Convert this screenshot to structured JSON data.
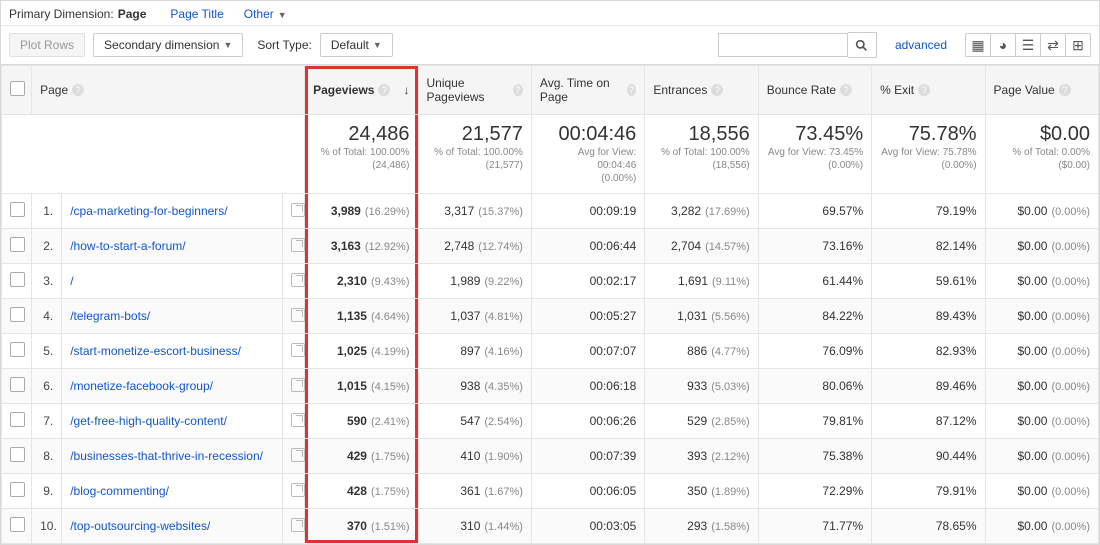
{
  "top": {
    "primary_dim_label": "Primary Dimension:",
    "primary_dim_value": "Page",
    "page_title_link": "Page Title",
    "other_link": "Other"
  },
  "controls": {
    "plot_rows": "Plot Rows",
    "secondary_dim": "Secondary dimension",
    "sort_type_label": "Sort Type:",
    "sort_type_value": "Default",
    "advanced": "advanced",
    "search_placeholder": ""
  },
  "headers": {
    "page": "Page",
    "pageviews": "Pageviews",
    "unique": "Unique Pageviews",
    "avgtime": "Avg. Time on Page",
    "entrances": "Entrances",
    "bounce": "Bounce Rate",
    "exit": "% Exit",
    "value": "Page Value"
  },
  "summary": {
    "pageviews": {
      "v": "24,486",
      "sub1": "% of Total: 100.00%",
      "sub2": "(24,486)"
    },
    "unique": {
      "v": "21,577",
      "sub1": "% of Total: 100.00%",
      "sub2": "(21,577)"
    },
    "avgtime": {
      "v": "00:04:46",
      "sub1": "Avg for View: 00:04:46",
      "sub2": "(0.00%)"
    },
    "entrances": {
      "v": "18,556",
      "sub1": "% of Total: 100.00%",
      "sub2": "(18,556)"
    },
    "bounce": {
      "v": "73.45%",
      "sub1": "Avg for View: 73.45%",
      "sub2": "(0.00%)"
    },
    "exit": {
      "v": "75.78%",
      "sub1": "Avg for View: 75.78%",
      "sub2": "(0.00%)"
    },
    "value": {
      "v": "$0.00",
      "sub1": "% of Total: 0.00%",
      "sub2": "($0.00)"
    }
  },
  "rows": [
    {
      "idx": "1.",
      "page": "/cpa-marketing-for-beginners/",
      "pv": "3,989",
      "pvp": "(16.29%)",
      "un": "3,317",
      "unp": "(15.37%)",
      "at": "00:09:19",
      "en": "3,282",
      "enp": "(17.69%)",
      "br": "69.57%",
      "ex": "79.19%",
      "vl": "$0.00",
      "vlp": "(0.00%)"
    },
    {
      "idx": "2.",
      "page": "/how-to-start-a-forum/",
      "pv": "3,163",
      "pvp": "(12.92%)",
      "un": "2,748",
      "unp": "(12.74%)",
      "at": "00:06:44",
      "en": "2,704",
      "enp": "(14.57%)",
      "br": "73.16%",
      "ex": "82.14%",
      "vl": "$0.00",
      "vlp": "(0.00%)"
    },
    {
      "idx": "3.",
      "page": "/",
      "pv": "2,310",
      "pvp": "(9.43%)",
      "un": "1,989",
      "unp": "(9.22%)",
      "at": "00:02:17",
      "en": "1,691",
      "enp": "(9.11%)",
      "br": "61.44%",
      "ex": "59.61%",
      "vl": "$0.00",
      "vlp": "(0.00%)"
    },
    {
      "idx": "4.",
      "page": "/telegram-bots/",
      "pv": "1,135",
      "pvp": "(4.64%)",
      "un": "1,037",
      "unp": "(4.81%)",
      "at": "00:05:27",
      "en": "1,031",
      "enp": "(5.56%)",
      "br": "84.22%",
      "ex": "89.43%",
      "vl": "$0.00",
      "vlp": "(0.00%)"
    },
    {
      "idx": "5.",
      "page": "/start-monetize-escort-business/",
      "pv": "1,025",
      "pvp": "(4.19%)",
      "un": "897",
      "unp": "(4.16%)",
      "at": "00:07:07",
      "en": "886",
      "enp": "(4.77%)",
      "br": "76.09%",
      "ex": "82.93%",
      "vl": "$0.00",
      "vlp": "(0.00%)"
    },
    {
      "idx": "6.",
      "page": "/monetize-facebook-group/",
      "pv": "1,015",
      "pvp": "(4.15%)",
      "un": "938",
      "unp": "(4.35%)",
      "at": "00:06:18",
      "en": "933",
      "enp": "(5.03%)",
      "br": "80.06%",
      "ex": "89.46%",
      "vl": "$0.00",
      "vlp": "(0.00%)"
    },
    {
      "idx": "7.",
      "page": "/get-free-high-quality-content/",
      "pv": "590",
      "pvp": "(2.41%)",
      "un": "547",
      "unp": "(2.54%)",
      "at": "00:06:26",
      "en": "529",
      "enp": "(2.85%)",
      "br": "79.81%",
      "ex": "87.12%",
      "vl": "$0.00",
      "vlp": "(0.00%)"
    },
    {
      "idx": "8.",
      "page": "/businesses-that-thrive-in-recession/",
      "pv": "429",
      "pvp": "(1.75%)",
      "un": "410",
      "unp": "(1.90%)",
      "at": "00:07:39",
      "en": "393",
      "enp": "(2.12%)",
      "br": "75.38%",
      "ex": "90.44%",
      "vl": "$0.00",
      "vlp": "(0.00%)"
    },
    {
      "idx": "9.",
      "page": "/blog-commenting/",
      "pv": "428",
      "pvp": "(1.75%)",
      "un": "361",
      "unp": "(1.67%)",
      "at": "00:06:05",
      "en": "350",
      "enp": "(1.89%)",
      "br": "72.29%",
      "ex": "79.91%",
      "vl": "$0.00",
      "vlp": "(0.00%)"
    },
    {
      "idx": "10.",
      "page": "/top-outsourcing-websites/",
      "pv": "370",
      "pvp": "(1.51%)",
      "un": "310",
      "unp": "(1.44%)",
      "at": "00:03:05",
      "en": "293",
      "enp": "(1.58%)",
      "br": "71.77%",
      "ex": "78.65%",
      "vl": "$0.00",
      "vlp": "(0.00%)"
    }
  ],
  "chart_data": {
    "type": "table",
    "title": "Pageviews by Page",
    "columns": [
      "Page",
      "Pageviews",
      "Unique Pageviews",
      "Avg. Time on Page",
      "Entrances",
      "Bounce Rate",
      "% Exit",
      "Page Value"
    ],
    "rows": [
      [
        "/cpa-marketing-for-beginners/",
        3989,
        3317,
        "00:09:19",
        3282,
        69.57,
        79.19,
        0.0
      ],
      [
        "/how-to-start-a-forum/",
        3163,
        2748,
        "00:06:44",
        2704,
        73.16,
        82.14,
        0.0
      ],
      [
        "/",
        2310,
        1989,
        "00:02:17",
        1691,
        61.44,
        59.61,
        0.0
      ],
      [
        "/telegram-bots/",
        1135,
        1037,
        "00:05:27",
        1031,
        84.22,
        89.43,
        0.0
      ],
      [
        "/start-monetize-escort-business/",
        1025,
        897,
        "00:07:07",
        886,
        76.09,
        82.93,
        0.0
      ],
      [
        "/monetize-facebook-group/",
        1015,
        938,
        "00:06:18",
        933,
        80.06,
        89.46,
        0.0
      ],
      [
        "/get-free-high-quality-content/",
        590,
        547,
        "00:06:26",
        529,
        79.81,
        87.12,
        0.0
      ],
      [
        "/businesses-that-thrive-in-recession/",
        429,
        410,
        "00:07:39",
        393,
        75.38,
        90.44,
        0.0
      ],
      [
        "/blog-commenting/",
        428,
        361,
        "00:06:05",
        350,
        72.29,
        79.91,
        0.0
      ],
      [
        "/top-outsourcing-websites/",
        370,
        310,
        "00:03:05",
        293,
        71.77,
        78.65,
        0.0
      ]
    ],
    "totals": {
      "Pageviews": 24486,
      "Unique Pageviews": 21577,
      "Avg. Time on Page": "00:04:46",
      "Entrances": 18556,
      "Bounce Rate": 73.45,
      "% Exit": 75.78,
      "Page Value": 0.0
    }
  }
}
